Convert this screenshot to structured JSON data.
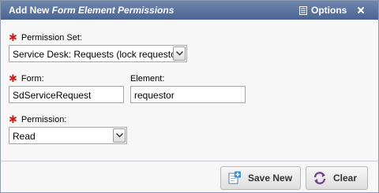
{
  "dialog": {
    "title_prefix": "Add New ",
    "title_italic": "Form Element Permissions",
    "options_label": "Options",
    "close_glyph": "×"
  },
  "fields": {
    "permission_set": {
      "label": "Permission Set:",
      "required": true,
      "value": "Service Desk: Requests (lock requestor)"
    },
    "form": {
      "label": "Form:",
      "required": true,
      "value": "SdServiceRequest"
    },
    "element": {
      "label": "Element:",
      "required": false,
      "value": "requestor"
    },
    "permission": {
      "label": "Permission:",
      "required": true,
      "value": "Read"
    }
  },
  "required_marker": "✱",
  "buttons": {
    "save_new": "Save New",
    "clear": "Clear"
  },
  "icons": {
    "options": "options-icon",
    "close": "close-icon",
    "save_new": "add-document-icon",
    "clear": "refresh-icon",
    "dropdown": "chevron-down-icon"
  },
  "colors": {
    "titlebar": "#5a74a1",
    "required": "#c8211b",
    "clear_icon": "#7a3f8c",
    "save_icon": "#3a8fd1"
  }
}
